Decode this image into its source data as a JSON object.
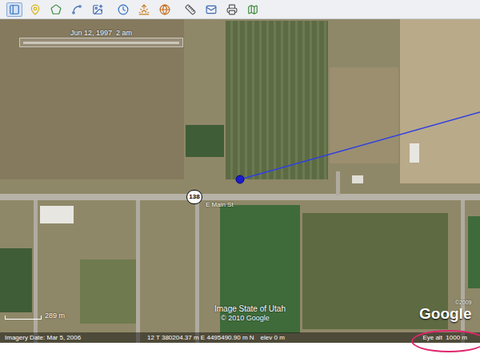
{
  "time_slider": {
    "label": "Jun 12, 1997  2 am"
  },
  "map": {
    "route_shield": "138",
    "street": "E Main St",
    "image_credit": "Image State of Utah",
    "copyright": "© 2010 Google",
    "logo_copyright": "©2009",
    "logo": "Google",
    "scale": "289 m"
  },
  "status_bar": {
    "imagery_date": "Imagery Date: Mar 5, 2006",
    "coordinates": "12 T 380204.37 m E 4495490.90 m N",
    "elevation": "elev 0 m",
    "eye_altitude": "Eye alt  1000 m",
    "eye_altitude_highlighted": true
  }
}
